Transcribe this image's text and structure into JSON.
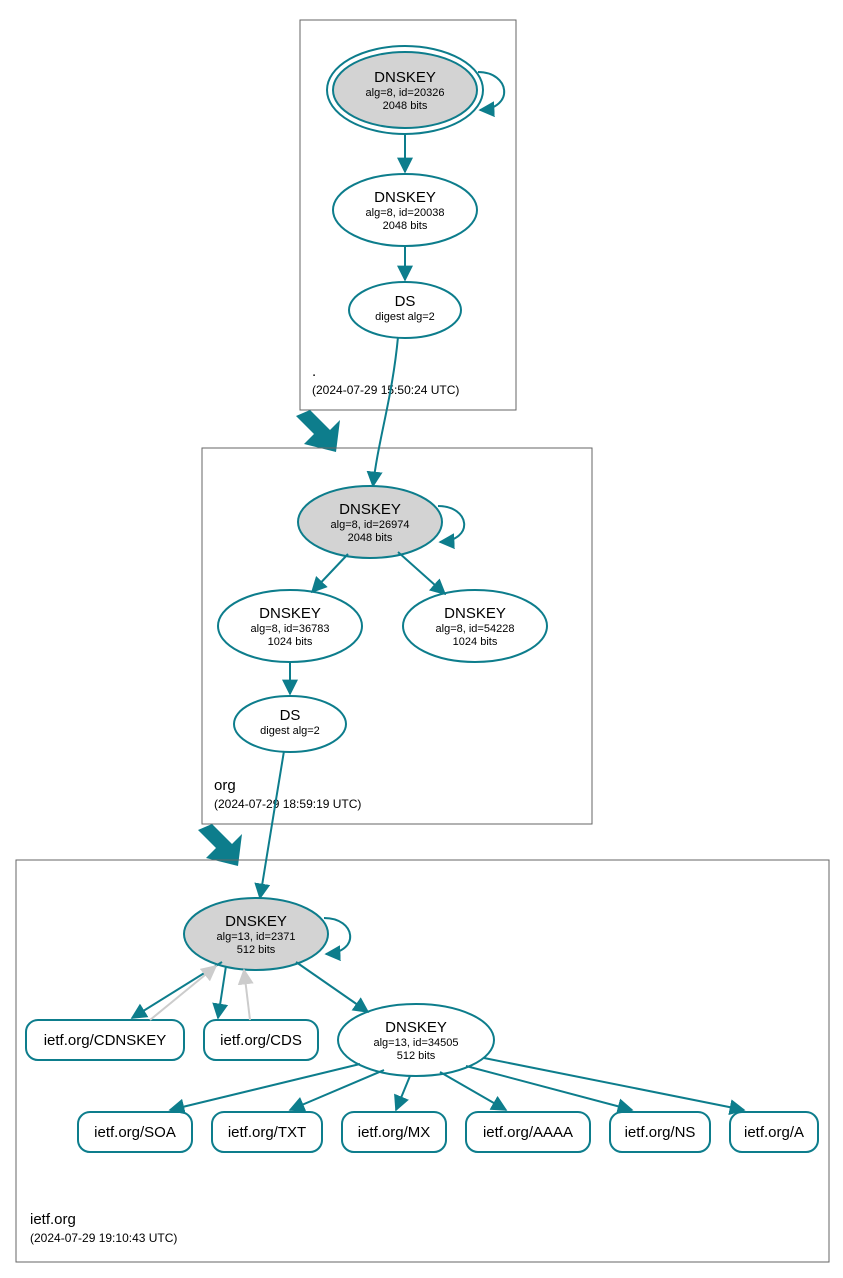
{
  "colors": {
    "stroke": "#0d7d8c",
    "ksk_fill": "#d3d3d3"
  },
  "zones": {
    "root": {
      "name": ".",
      "timestamp": "(2024-07-29 15:50:24 UTC)"
    },
    "org": {
      "name": "org",
      "timestamp": "(2024-07-29 18:59:19 UTC)"
    },
    "ietf": {
      "name": "ietf.org",
      "timestamp": "(2024-07-29 19:10:43 UTC)"
    }
  },
  "nodes": {
    "root_ksk": {
      "title": "DNSKEY",
      "l2": "alg=8, id=20326",
      "l3": "2048 bits"
    },
    "root_zsk": {
      "title": "DNSKEY",
      "l2": "alg=8, id=20038",
      "l3": "2048 bits"
    },
    "root_ds": {
      "title": "DS",
      "l2": "digest alg=2"
    },
    "org_ksk": {
      "title": "DNSKEY",
      "l2": "alg=8, id=26974",
      "l3": "2048 bits"
    },
    "org_zsk1": {
      "title": "DNSKEY",
      "l2": "alg=8, id=36783",
      "l3": "1024 bits"
    },
    "org_zsk2": {
      "title": "DNSKEY",
      "l2": "alg=8, id=54228",
      "l3": "1024 bits"
    },
    "org_ds": {
      "title": "DS",
      "l2": "digest alg=2"
    },
    "ietf_ksk": {
      "title": "DNSKEY",
      "l2": "alg=13, id=2371",
      "l3": "512 bits"
    },
    "ietf_zsk": {
      "title": "DNSKEY",
      "l2": "alg=13, id=34505",
      "l3": "512 bits"
    },
    "ietf_cdnskey": {
      "label": "ietf.org/CDNSKEY"
    },
    "ietf_cds": {
      "label": "ietf.org/CDS"
    },
    "ietf_soa": {
      "label": "ietf.org/SOA"
    },
    "ietf_txt": {
      "label": "ietf.org/TXT"
    },
    "ietf_mx": {
      "label": "ietf.org/MX"
    },
    "ietf_aaaa": {
      "label": "ietf.org/AAAA"
    },
    "ietf_ns": {
      "label": "ietf.org/NS"
    },
    "ietf_a": {
      "label": "ietf.org/A"
    }
  },
  "chart_data": {
    "type": "graph",
    "description": "DNSSEC authentication chain for ietf.org",
    "zones": [
      {
        "id": "root",
        "label": ".",
        "timestamp": "2024-07-29 15:50:24 UTC"
      },
      {
        "id": "org",
        "label": "org",
        "timestamp": "2024-07-29 18:59:19 UTC"
      },
      {
        "id": "ietf",
        "label": "ietf.org",
        "timestamp": "2024-07-29 19:10:43 UTC"
      }
    ],
    "nodes": [
      {
        "id": "root_ksk",
        "zone": "root",
        "type": "DNSKEY",
        "alg": 8,
        "id_tag": 20326,
        "bits": 2048,
        "ksk": true,
        "trust_anchor": true
      },
      {
        "id": "root_zsk",
        "zone": "root",
        "type": "DNSKEY",
        "alg": 8,
        "id_tag": 20038,
        "bits": 2048
      },
      {
        "id": "root_ds",
        "zone": "root",
        "type": "DS",
        "digest_alg": 2
      },
      {
        "id": "org_ksk",
        "zone": "org",
        "type": "DNSKEY",
        "alg": 8,
        "id_tag": 26974,
        "bits": 2048,
        "ksk": true
      },
      {
        "id": "org_zsk1",
        "zone": "org",
        "type": "DNSKEY",
        "alg": 8,
        "id_tag": 36783,
        "bits": 1024
      },
      {
        "id": "org_zsk2",
        "zone": "org",
        "type": "DNSKEY",
        "alg": 8,
        "id_tag": 54228,
        "bits": 1024
      },
      {
        "id": "org_ds",
        "zone": "org",
        "type": "DS",
        "digest_alg": 2
      },
      {
        "id": "ietf_ksk",
        "zone": "ietf",
        "type": "DNSKEY",
        "alg": 13,
        "id_tag": 2371,
        "bits": 512,
        "ksk": true
      },
      {
        "id": "ietf_zsk",
        "zone": "ietf",
        "type": "DNSKEY",
        "alg": 13,
        "id_tag": 34505,
        "bits": 512
      },
      {
        "id": "ietf_cdnskey",
        "zone": "ietf",
        "type": "RRset",
        "name": "ietf.org/CDNSKEY"
      },
      {
        "id": "ietf_cds",
        "zone": "ietf",
        "type": "RRset",
        "name": "ietf.org/CDS"
      },
      {
        "id": "ietf_soa",
        "zone": "ietf",
        "type": "RRset",
        "name": "ietf.org/SOA"
      },
      {
        "id": "ietf_txt",
        "zone": "ietf",
        "type": "RRset",
        "name": "ietf.org/TXT"
      },
      {
        "id": "ietf_mx",
        "zone": "ietf",
        "type": "RRset",
        "name": "ietf.org/MX"
      },
      {
        "id": "ietf_aaaa",
        "zone": "ietf",
        "type": "RRset",
        "name": "ietf.org/AAAA"
      },
      {
        "id": "ietf_ns",
        "zone": "ietf",
        "type": "RRset",
        "name": "ietf.org/NS"
      },
      {
        "id": "ietf_a",
        "zone": "ietf",
        "type": "RRset",
        "name": "ietf.org/A"
      }
    ],
    "edges": [
      {
        "from": "root_ksk",
        "to": "root_ksk",
        "kind": "self-sign"
      },
      {
        "from": "root_ksk",
        "to": "root_zsk",
        "kind": "signs"
      },
      {
        "from": "root_zsk",
        "to": "root_ds",
        "kind": "signs"
      },
      {
        "from": "root_ds",
        "to": "org_ksk",
        "kind": "delegation"
      },
      {
        "from": "root",
        "to": "org",
        "kind": "zone-delegation"
      },
      {
        "from": "org_ksk",
        "to": "org_ksk",
        "kind": "self-sign"
      },
      {
        "from": "org_ksk",
        "to": "org_zsk1",
        "kind": "signs"
      },
      {
        "from": "org_ksk",
        "to": "org_zsk2",
        "kind": "signs"
      },
      {
        "from": "org_zsk1",
        "to": "org_ds",
        "kind": "signs"
      },
      {
        "from": "org_ds",
        "to": "ietf_ksk",
        "kind": "delegation"
      },
      {
        "from": "org",
        "to": "ietf",
        "kind": "zone-delegation"
      },
      {
        "from": "ietf_ksk",
        "to": "ietf_ksk",
        "kind": "self-sign"
      },
      {
        "from": "ietf_ksk",
        "to": "ietf_zsk",
        "kind": "signs"
      },
      {
        "from": "ietf_ksk",
        "to": "ietf_cdnskey",
        "kind": "signs"
      },
      {
        "from": "ietf_ksk",
        "to": "ietf_cds",
        "kind": "signs"
      },
      {
        "from": "ietf_cdnskey",
        "to": "ietf_ksk",
        "kind": "provides",
        "style": "light"
      },
      {
        "from": "ietf_cds",
        "to": "ietf_ksk",
        "kind": "provides",
        "style": "light"
      },
      {
        "from": "ietf_zsk",
        "to": "ietf_soa",
        "kind": "signs"
      },
      {
        "from": "ietf_zsk",
        "to": "ietf_txt",
        "kind": "signs"
      },
      {
        "from": "ietf_zsk",
        "to": "ietf_mx",
        "kind": "signs"
      },
      {
        "from": "ietf_zsk",
        "to": "ietf_aaaa",
        "kind": "signs"
      },
      {
        "from": "ietf_zsk",
        "to": "ietf_ns",
        "kind": "signs"
      },
      {
        "from": "ietf_zsk",
        "to": "ietf_a",
        "kind": "signs"
      }
    ]
  }
}
